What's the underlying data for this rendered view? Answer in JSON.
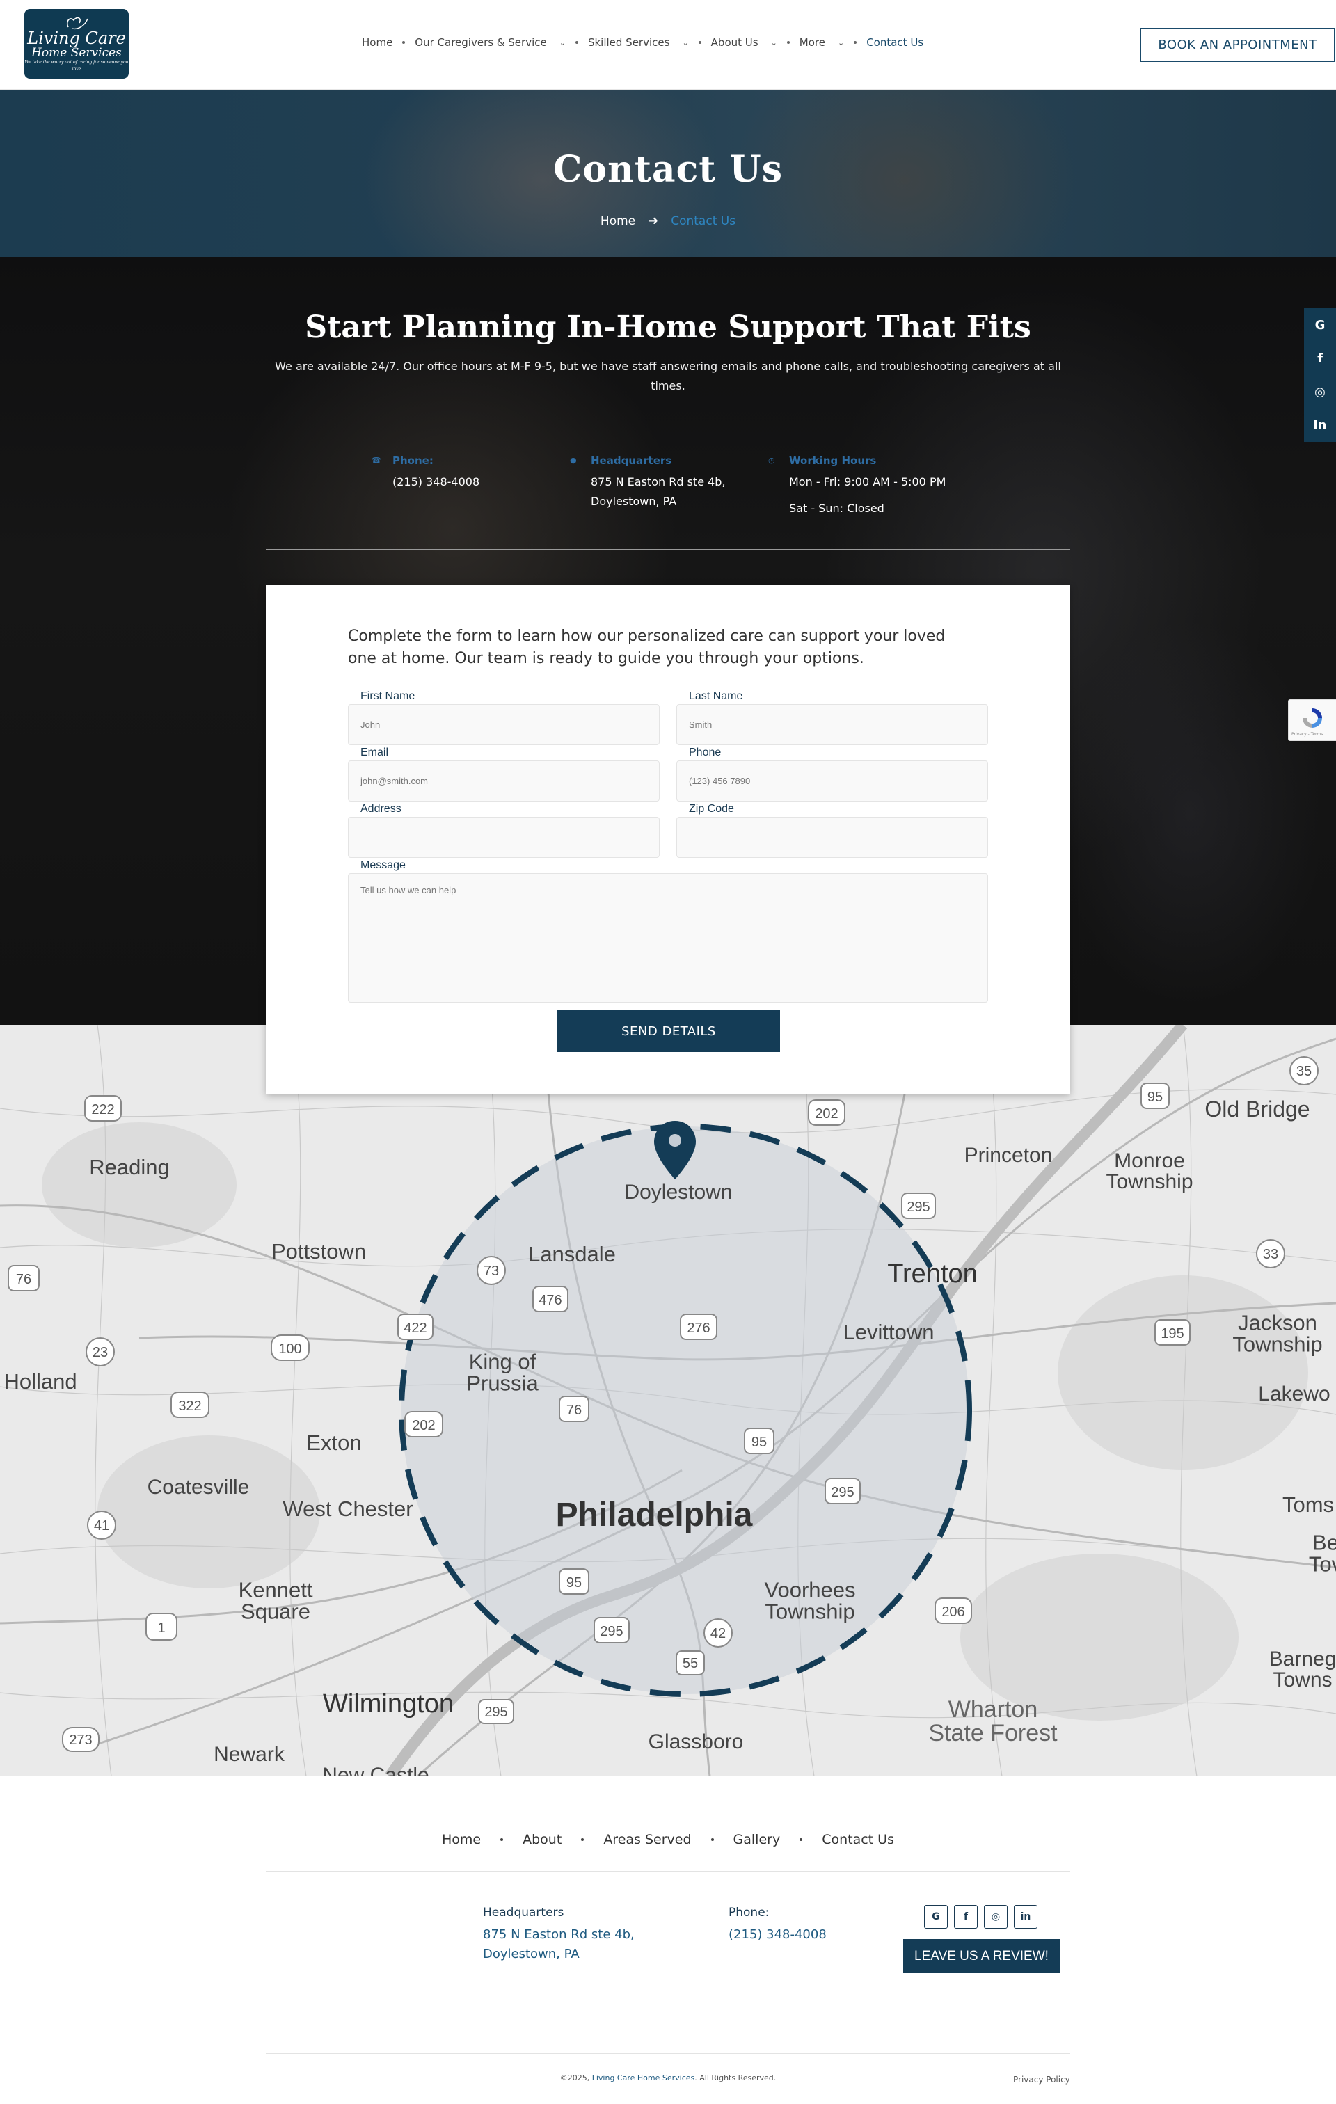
{
  "logo": {
    "line1": "Living Care",
    "line2": "Home Services",
    "tagline": "We take the worry out of caring for someone you love"
  },
  "nav": {
    "items": [
      {
        "label": "Home",
        "dropdown": false
      },
      {
        "label": "Our Caregivers & Service",
        "dropdown": true
      },
      {
        "label": "Skilled Services",
        "dropdown": true
      },
      {
        "label": "About Us",
        "dropdown": true
      },
      {
        "label": "More",
        "dropdown": true
      },
      {
        "label": "Contact Us",
        "dropdown": false,
        "active": true
      }
    ],
    "book_label": "BOOK AN APPOINTMENT"
  },
  "hero": {
    "title": "Contact Us",
    "crumb_home": "Home",
    "crumb_current": "Contact Us"
  },
  "plan": {
    "title": "Start Planning In-Home Support That Fits",
    "subtitle": "We are available 24/7. Our office hours at M-F 9-5, but we have staff answering emails and phone calls, and troubleshooting caregivers at all times."
  },
  "contact_info": {
    "phone_label": "Phone:",
    "phone": "(215) 348-4008",
    "hq_label": "Headquarters",
    "hq_line1": "875 N Easton Rd ste 4b,",
    "hq_line2": "Doylestown, PA",
    "hours_label": "Working Hours",
    "hours_line1": "Mon - Fri: 9:00 AM - 5:00 PM",
    "hours_line2": "Sat - Sun: Closed"
  },
  "form": {
    "intro": "Complete the form to learn how our personalized care can support your loved one at home. Our team is ready to guide you through your options.",
    "first_name_label": "First Name",
    "first_name_placeholder": "John",
    "last_name_label": "Last Name",
    "last_name_placeholder": "Smith",
    "email_label": "Email",
    "email_placeholder": "john@smith.com",
    "phone_label": "Phone",
    "phone_placeholder": "(123) 456 7890",
    "address_label": "Address",
    "address_placeholder": "",
    "zip_label": "Zip Code",
    "zip_placeholder": "",
    "message_label": "Message",
    "message_placeholder": "Tell us how we can help",
    "send_label": "SEND DETAILS"
  },
  "socials": [
    "G",
    "f",
    "◎",
    "in"
  ],
  "recaptcha_text": "Privacy - Terms",
  "map": {
    "places": {
      "doylestown": "Doylestown",
      "reading": "Reading",
      "pottstown": "Pottstown",
      "lansdale": "Lansdale",
      "trenton": "Trenton",
      "levittown": "Levittown",
      "princeton": "Princeton",
      "monroe": "Monroe\nTownship",
      "oldbridge": "Old Bridge",
      "jackson": "Jackson\nTownship",
      "lakewood": "Lakewo",
      "kingofprussia": "King of\nPrussia",
      "holland": "Holland",
      "exton": "Exton",
      "coatesville": "Coatesville",
      "westchester": "West Chester",
      "philadelphia": "Philadelphia",
      "kennett": "Kennett\nSquare",
      "voorhees": "Voorhees\nTownship",
      "wilmington": "Wilmington",
      "newark": "Newark",
      "newcastle": "New Castle",
      "glassboro": "Glassboro",
      "wharton": "Wharton\nState Forest",
      "toms": "Toms",
      "be": "Be\nTov",
      "barnegat": "Barneg\nTowns"
    },
    "shields": [
      "222",
      "202",
      "35",
      "95",
      "295",
      "73",
      "476",
      "76",
      "276",
      "33",
      "195",
      "23",
      "100",
      "322",
      "202",
      "76",
      "95",
      "295",
      "41",
      "1",
      "95",
      "295",
      "42",
      "55",
      "206",
      "273",
      "295",
      "422"
    ]
  },
  "footer": {
    "nav": [
      "Home",
      "About",
      "Areas Served",
      "Gallery",
      "Contact Us"
    ],
    "hq_label": "Headquarters",
    "hq_line1": "875 N Easton Rd ste 4b,",
    "hq_line2": "Doylestown, PA",
    "phone_label": "Phone:",
    "phone": "(215) 348-4008",
    "icons": [
      "G",
      "f",
      "◎",
      "in"
    ],
    "review_label": "LEAVE US A REVIEW!",
    "copyright_prefix": "©2025, ",
    "copyright_brand": "Living Care Home Services",
    "copyright_suffix": ". All Rights Reserved.",
    "privacy": "Privacy Policy"
  },
  "colors": {
    "brand_dark": "#143c56",
    "accent_blue": "#2e6da4",
    "link_blue": "#2e86c1"
  }
}
